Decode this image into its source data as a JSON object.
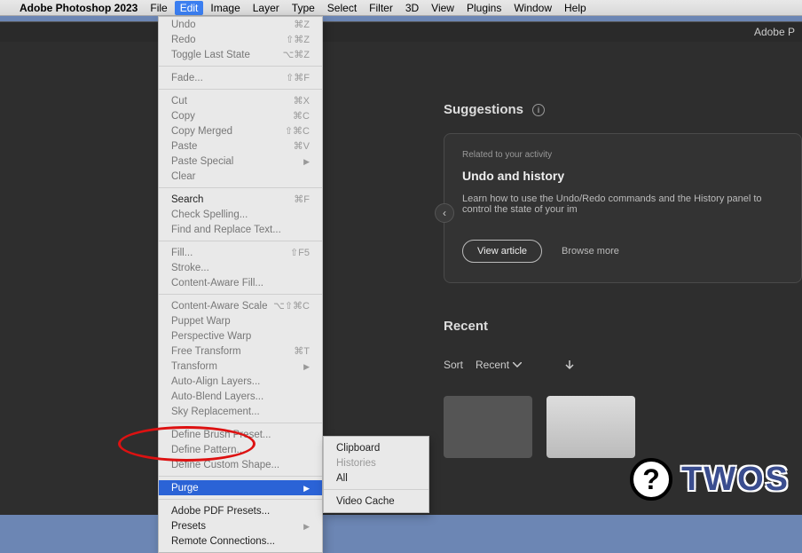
{
  "menubar": {
    "app_name": "Adobe Photoshop 2023",
    "items": [
      "File",
      "Edit",
      "Image",
      "Layer",
      "Type",
      "Select",
      "Filter",
      "3D",
      "View",
      "Plugins",
      "Window",
      "Help"
    ],
    "open_index": 1
  },
  "window": {
    "title": "Adobe P"
  },
  "suggestions": {
    "heading": "Suggestions",
    "card": {
      "related": "Related to your activity",
      "title": "Undo and history",
      "desc": "Learn how to use the Undo/Redo commands and the History panel to control the state of your im",
      "view_article": "View article",
      "browse_more": "Browse more"
    }
  },
  "recent": {
    "heading": "Recent",
    "sort_label": "Sort",
    "sort_value": "Recent"
  },
  "edit_menu": {
    "groups": [
      [
        {
          "label": "Undo",
          "sc": "⌘Z",
          "dark": false
        },
        {
          "label": "Redo",
          "sc": "⇧⌘Z",
          "dark": false
        },
        {
          "label": "Toggle Last State",
          "sc": "⌥⌘Z",
          "dark": false
        }
      ],
      [
        {
          "label": "Fade...",
          "sc": "⇧⌘F",
          "dark": false
        }
      ],
      [
        {
          "label": "Cut",
          "sc": "⌘X",
          "dark": false
        },
        {
          "label": "Copy",
          "sc": "⌘C",
          "dark": false
        },
        {
          "label": "Copy Merged",
          "sc": "⇧⌘C",
          "dark": false
        },
        {
          "label": "Paste",
          "sc": "⌘V",
          "dark": false
        },
        {
          "label": "Paste Special",
          "sub": true,
          "dark": false
        },
        {
          "label": "Clear",
          "dark": false
        }
      ],
      [
        {
          "label": "Search",
          "sc": "⌘F",
          "dark": true
        },
        {
          "label": "Check Spelling...",
          "dark": false
        },
        {
          "label": "Find and Replace Text...",
          "dark": false
        }
      ],
      [
        {
          "label": "Fill...",
          "sc": "⇧F5",
          "dark": false
        },
        {
          "label": "Stroke...",
          "dark": false
        },
        {
          "label": "Content-Aware Fill...",
          "dark": false
        }
      ],
      [
        {
          "label": "Content-Aware Scale",
          "sc": "⌥⇧⌘C",
          "dark": false
        },
        {
          "label": "Puppet Warp",
          "dark": false
        },
        {
          "label": "Perspective Warp",
          "dark": false
        },
        {
          "label": "Free Transform",
          "sc": "⌘T",
          "dark": false
        },
        {
          "label": "Transform",
          "sub": true,
          "dark": false
        },
        {
          "label": "Auto-Align Layers...",
          "dark": false
        },
        {
          "label": "Auto-Blend Layers...",
          "dark": false
        },
        {
          "label": "Sky Replacement...",
          "dark": false
        }
      ],
      [
        {
          "label": "Define Brush Preset...",
          "dark": false
        },
        {
          "label": "Define Pattern...",
          "dark": false
        },
        {
          "label": "Define Custom Shape...",
          "dark": false
        }
      ],
      [
        {
          "label": "Purge",
          "sub": true,
          "dark": true,
          "highlight": true
        }
      ],
      [
        {
          "label": "Adobe PDF Presets...",
          "dark": true
        },
        {
          "label": "Presets",
          "sub": true,
          "dark": true
        },
        {
          "label": "Remote Connections...",
          "dark": true
        }
      ]
    ]
  },
  "purge_menu": {
    "items": [
      {
        "label": "Clipboard",
        "dim": false
      },
      {
        "label": "Histories",
        "dim": true
      },
      {
        "label": "All",
        "dim": false
      }
    ],
    "items2": [
      {
        "label": "Video Cache",
        "dim": false
      }
    ]
  },
  "watermark": {
    "circle": "?",
    "text": "TWOS"
  }
}
